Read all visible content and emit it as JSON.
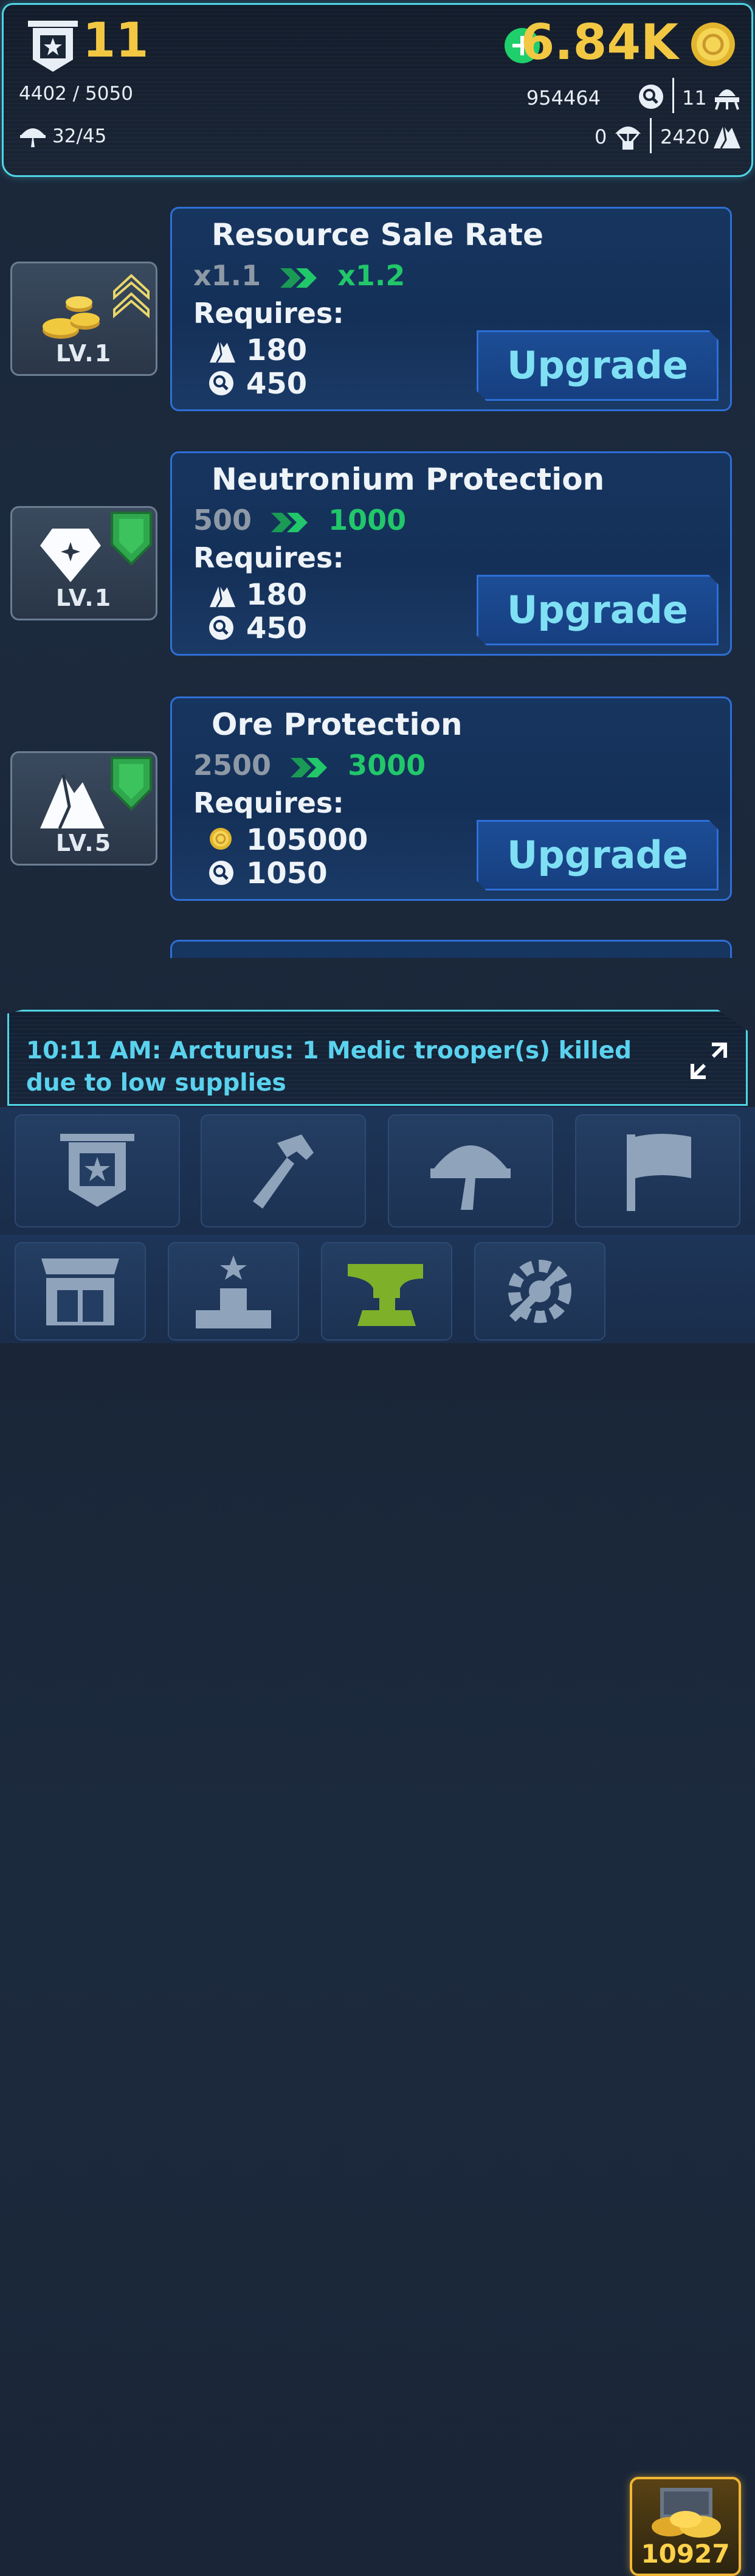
{
  "header": {
    "level": "11",
    "xp": "4402 / 5050",
    "troops": "32/45",
    "gold": "6.84K",
    "research_points": "954464",
    "ships": "11",
    "supply_drops": "0",
    "ore": "2420"
  },
  "upgrades": [
    {
      "badge_icon": "gold-coins-icon",
      "badge_level": "LV.1",
      "title": "Resource Sale Rate",
      "old_value": "x1.1",
      "new_value": "x1.2",
      "requires_label": "Requires:",
      "req1_icon": "ore-icon",
      "req1_value": "180",
      "req2_icon": "research-icon",
      "req2_value": "450",
      "button_label": "Upgrade"
    },
    {
      "badge_icon": "diamond-icon",
      "badge_level": "LV.1",
      "title": "Neutronium Protection",
      "old_value": "500",
      "new_value": "1000",
      "requires_label": "Requires:",
      "req1_icon": "ore-icon",
      "req1_value": "180",
      "req2_icon": "research-icon",
      "req2_value": "450",
      "button_label": "Upgrade"
    },
    {
      "badge_icon": "ore-mountain-icon",
      "badge_level": "LV.5",
      "title": "Ore Protection",
      "old_value": "2500",
      "new_value": "3000",
      "requires_label": "Requires:",
      "req1_icon": "gold-coin-icon",
      "req1_value": "105000",
      "req2_icon": "research-icon",
      "req2_value": "1050",
      "button_label": "Upgrade"
    }
  ],
  "message": {
    "text": "10:11 AM: Arcturus: 1 Medic trooper(s) killed due to low supplies"
  },
  "nav": {
    "row1": [
      "banner-icon",
      "hammer-icon",
      "helmet-icon",
      "flag-icon"
    ],
    "row2": [
      "shop-icon",
      "podium-icon",
      "anvil-icon",
      "settings-icon",
      "treasure-icon"
    ],
    "treasure_count": "10927"
  },
  "colors": {
    "accent_cyan": "#4fd6e6",
    "gold": "#f2c843",
    "green": "#21c76a",
    "button_text": "#7fe0f4"
  }
}
